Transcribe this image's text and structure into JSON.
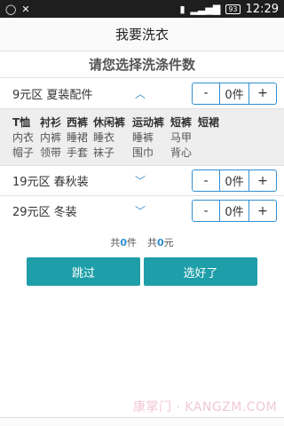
{
  "status_bar": {
    "left_icons": [
      "chat-icon",
      "signal-dismiss-icon"
    ],
    "battery": "93",
    "time": "12:29"
  },
  "title": "我要洗衣",
  "subtitle": "请您选择洗涤件数",
  "zones": [
    {
      "label": "9元区 夏装配件",
      "expanded": true,
      "minus": "-",
      "plus": "+",
      "count": "0件"
    },
    {
      "label": "19元区 春秋装",
      "expanded": false,
      "minus": "-",
      "plus": "+",
      "count": "0件"
    },
    {
      "label": "29元区 冬装",
      "expanded": false,
      "minus": "-",
      "plus": "+",
      "count": "0件"
    }
  ],
  "summer_items": {
    "row1": [
      "T恤",
      "衬衫",
      "西裤",
      "休闲裤",
      "运动裤",
      "短裤",
      "短裙"
    ],
    "row2": [
      "内衣",
      "内裤",
      "睡裙",
      "睡衣",
      "睡裤",
      "马甲"
    ],
    "row3": [
      "帽子",
      "领带",
      "手套",
      "袜子",
      "围巾",
      "背心"
    ]
  },
  "totals": {
    "count_prefix": "共",
    "count": "0",
    "count_suffix": "件",
    "price_prefix": "共",
    "price": "0",
    "price_suffix": "元"
  },
  "buttons": {
    "skip": "跳过",
    "done": "选好了"
  },
  "watermark": "康掌门 · KANGZM.COM",
  "colors": {
    "accent": "#2f8fd0",
    "button": "#1e9ea8",
    "status_bar": "#1e1e1e"
  }
}
